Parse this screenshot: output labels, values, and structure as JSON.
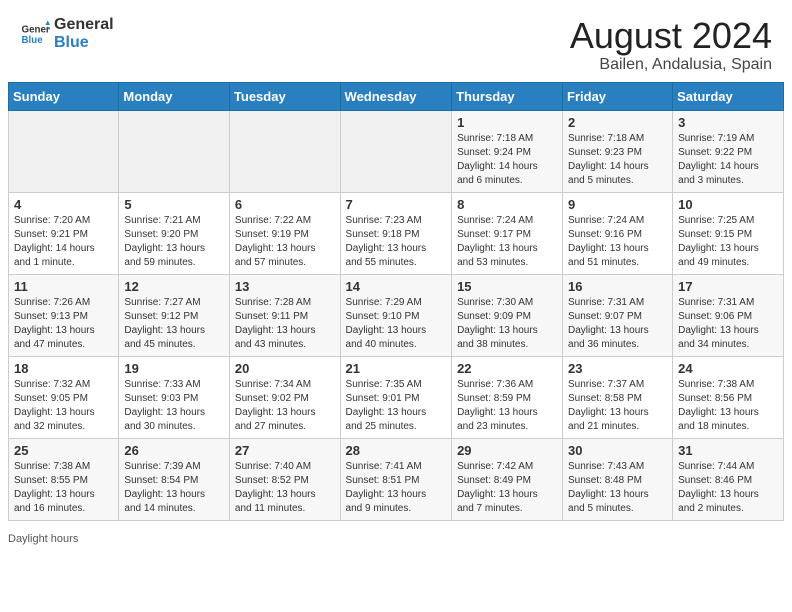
{
  "header": {
    "logo_line1": "General",
    "logo_line2": "Blue",
    "title": "August 2024",
    "subtitle": "Bailen, Andalusia, Spain"
  },
  "calendar": {
    "days_of_week": [
      "Sunday",
      "Monday",
      "Tuesday",
      "Wednesday",
      "Thursday",
      "Friday",
      "Saturday"
    ],
    "weeks": [
      [
        {
          "num": "",
          "info": ""
        },
        {
          "num": "",
          "info": ""
        },
        {
          "num": "",
          "info": ""
        },
        {
          "num": "",
          "info": ""
        },
        {
          "num": "1",
          "info": "Sunrise: 7:18 AM\nSunset: 9:24 PM\nDaylight: 14 hours\nand 6 minutes."
        },
        {
          "num": "2",
          "info": "Sunrise: 7:18 AM\nSunset: 9:23 PM\nDaylight: 14 hours\nand 5 minutes."
        },
        {
          "num": "3",
          "info": "Sunrise: 7:19 AM\nSunset: 9:22 PM\nDaylight: 14 hours\nand 3 minutes."
        }
      ],
      [
        {
          "num": "4",
          "info": "Sunrise: 7:20 AM\nSunset: 9:21 PM\nDaylight: 14 hours\nand 1 minute."
        },
        {
          "num": "5",
          "info": "Sunrise: 7:21 AM\nSunset: 9:20 PM\nDaylight: 13 hours\nand 59 minutes."
        },
        {
          "num": "6",
          "info": "Sunrise: 7:22 AM\nSunset: 9:19 PM\nDaylight: 13 hours\nand 57 minutes."
        },
        {
          "num": "7",
          "info": "Sunrise: 7:23 AM\nSunset: 9:18 PM\nDaylight: 13 hours\nand 55 minutes."
        },
        {
          "num": "8",
          "info": "Sunrise: 7:24 AM\nSunset: 9:17 PM\nDaylight: 13 hours\nand 53 minutes."
        },
        {
          "num": "9",
          "info": "Sunrise: 7:24 AM\nSunset: 9:16 PM\nDaylight: 13 hours\nand 51 minutes."
        },
        {
          "num": "10",
          "info": "Sunrise: 7:25 AM\nSunset: 9:15 PM\nDaylight: 13 hours\nand 49 minutes."
        }
      ],
      [
        {
          "num": "11",
          "info": "Sunrise: 7:26 AM\nSunset: 9:13 PM\nDaylight: 13 hours\nand 47 minutes."
        },
        {
          "num": "12",
          "info": "Sunrise: 7:27 AM\nSunset: 9:12 PM\nDaylight: 13 hours\nand 45 minutes."
        },
        {
          "num": "13",
          "info": "Sunrise: 7:28 AM\nSunset: 9:11 PM\nDaylight: 13 hours\nand 43 minutes."
        },
        {
          "num": "14",
          "info": "Sunrise: 7:29 AM\nSunset: 9:10 PM\nDaylight: 13 hours\nand 40 minutes."
        },
        {
          "num": "15",
          "info": "Sunrise: 7:30 AM\nSunset: 9:09 PM\nDaylight: 13 hours\nand 38 minutes."
        },
        {
          "num": "16",
          "info": "Sunrise: 7:31 AM\nSunset: 9:07 PM\nDaylight: 13 hours\nand 36 minutes."
        },
        {
          "num": "17",
          "info": "Sunrise: 7:31 AM\nSunset: 9:06 PM\nDaylight: 13 hours\nand 34 minutes."
        }
      ],
      [
        {
          "num": "18",
          "info": "Sunrise: 7:32 AM\nSunset: 9:05 PM\nDaylight: 13 hours\nand 32 minutes."
        },
        {
          "num": "19",
          "info": "Sunrise: 7:33 AM\nSunset: 9:03 PM\nDaylight: 13 hours\nand 30 minutes."
        },
        {
          "num": "20",
          "info": "Sunrise: 7:34 AM\nSunset: 9:02 PM\nDaylight: 13 hours\nand 27 minutes."
        },
        {
          "num": "21",
          "info": "Sunrise: 7:35 AM\nSunset: 9:01 PM\nDaylight: 13 hours\nand 25 minutes."
        },
        {
          "num": "22",
          "info": "Sunrise: 7:36 AM\nSunset: 8:59 PM\nDaylight: 13 hours\nand 23 minutes."
        },
        {
          "num": "23",
          "info": "Sunrise: 7:37 AM\nSunset: 8:58 PM\nDaylight: 13 hours\nand 21 minutes."
        },
        {
          "num": "24",
          "info": "Sunrise: 7:38 AM\nSunset: 8:56 PM\nDaylight: 13 hours\nand 18 minutes."
        }
      ],
      [
        {
          "num": "25",
          "info": "Sunrise: 7:38 AM\nSunset: 8:55 PM\nDaylight: 13 hours\nand 16 minutes."
        },
        {
          "num": "26",
          "info": "Sunrise: 7:39 AM\nSunset: 8:54 PM\nDaylight: 13 hours\nand 14 minutes."
        },
        {
          "num": "27",
          "info": "Sunrise: 7:40 AM\nSunset: 8:52 PM\nDaylight: 13 hours\nand 11 minutes."
        },
        {
          "num": "28",
          "info": "Sunrise: 7:41 AM\nSunset: 8:51 PM\nDaylight: 13 hours\nand 9 minutes."
        },
        {
          "num": "29",
          "info": "Sunrise: 7:42 AM\nSunset: 8:49 PM\nDaylight: 13 hours\nand 7 minutes."
        },
        {
          "num": "30",
          "info": "Sunrise: 7:43 AM\nSunset: 8:48 PM\nDaylight: 13 hours\nand 5 minutes."
        },
        {
          "num": "31",
          "info": "Sunrise: 7:44 AM\nSunset: 8:46 PM\nDaylight: 13 hours\nand 2 minutes."
        }
      ]
    ]
  },
  "footer": {
    "text": "Daylight hours"
  }
}
